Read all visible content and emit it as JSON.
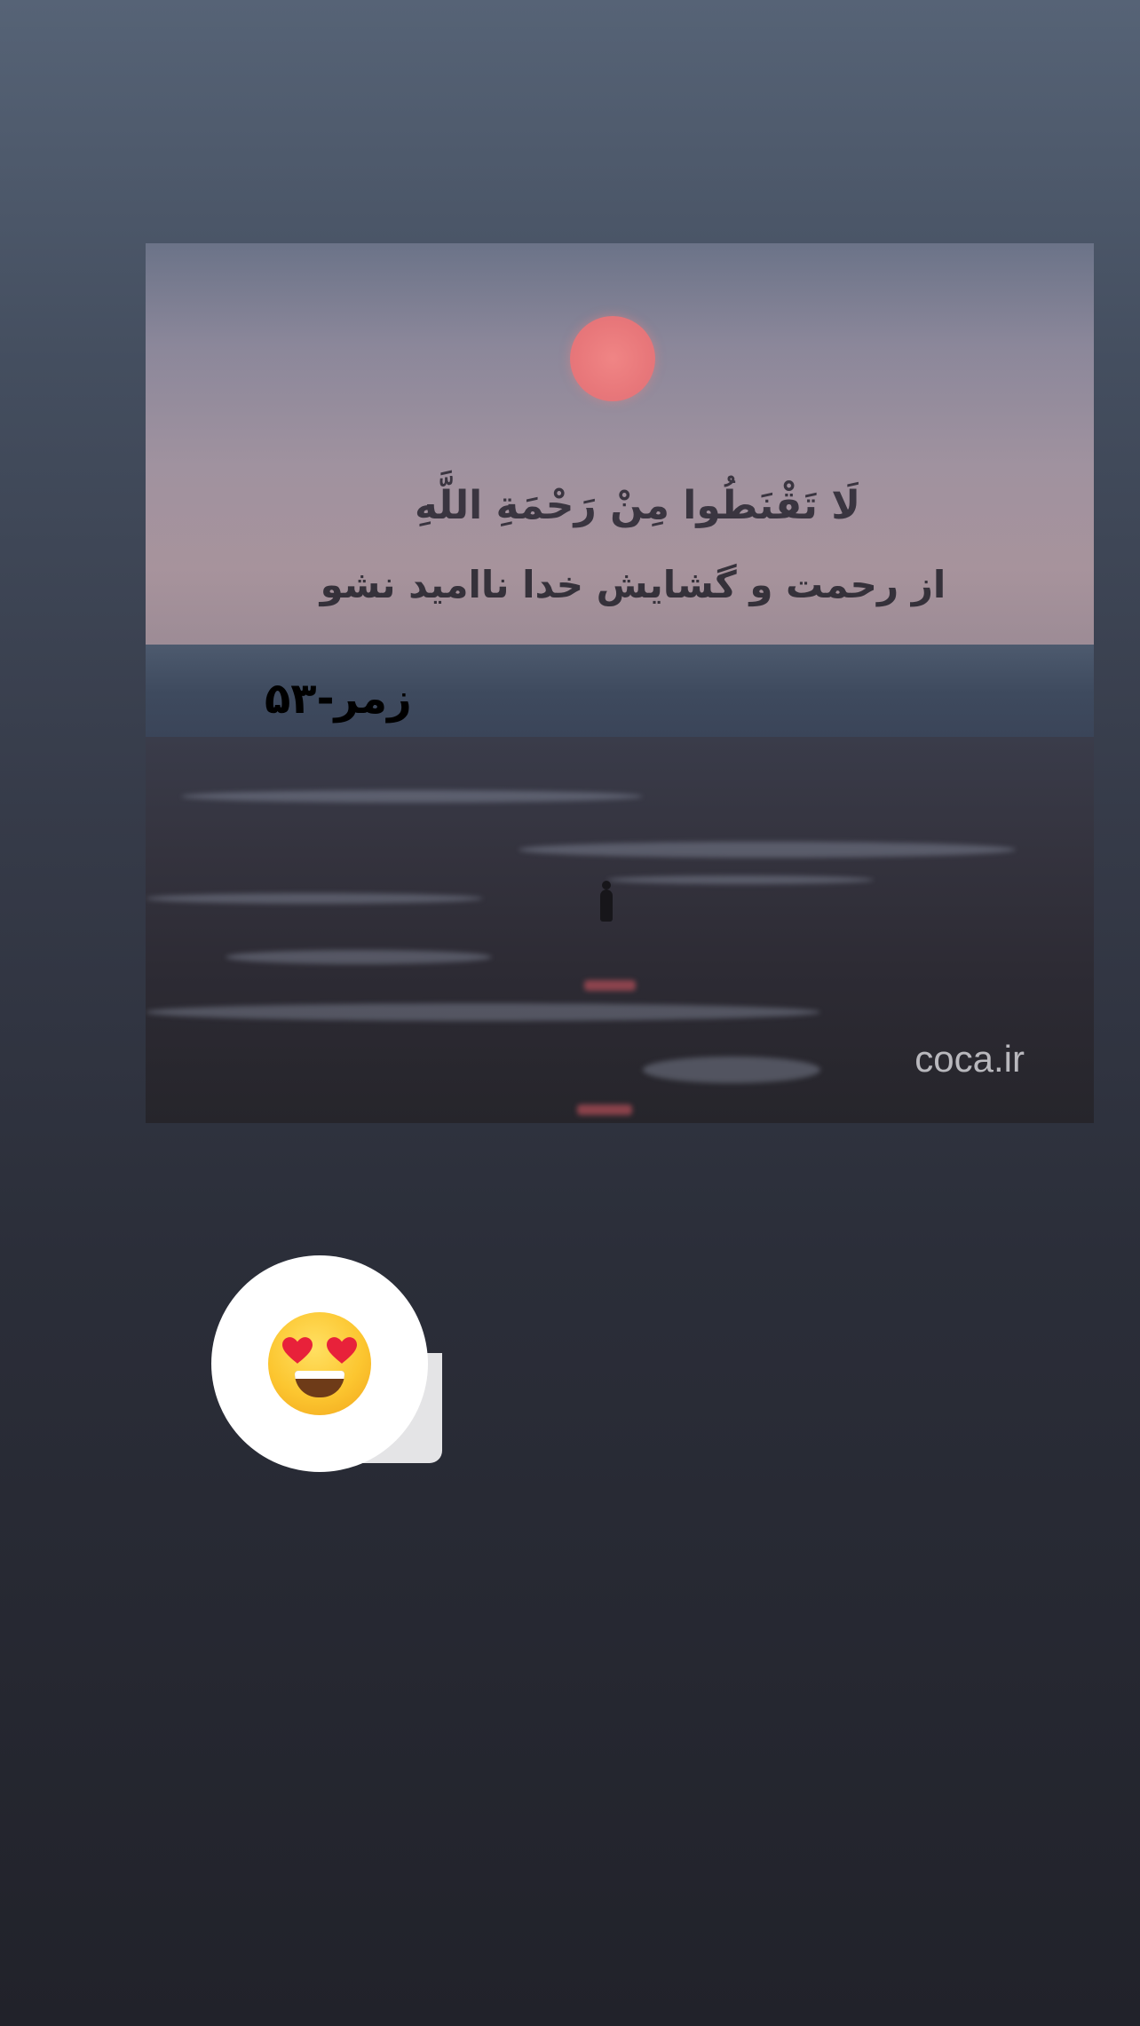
{
  "story": {
    "verse_arabic": "لَا تَقْنَطُوا مِنْ رَحْمَةِ اللَّهِ",
    "verse_persian": "از رحمت و گشایش خدا ناامید نشو",
    "surah_reference": "زمر-۵۳",
    "watermark": "coca.ir"
  },
  "reaction": {
    "emoji": "smiling-face-with-heart-eyes-icon"
  },
  "colors": {
    "sun": "#e8777a",
    "bubble": "#ffffff",
    "background_top": "#566376",
    "background_bottom": "#21222a"
  }
}
